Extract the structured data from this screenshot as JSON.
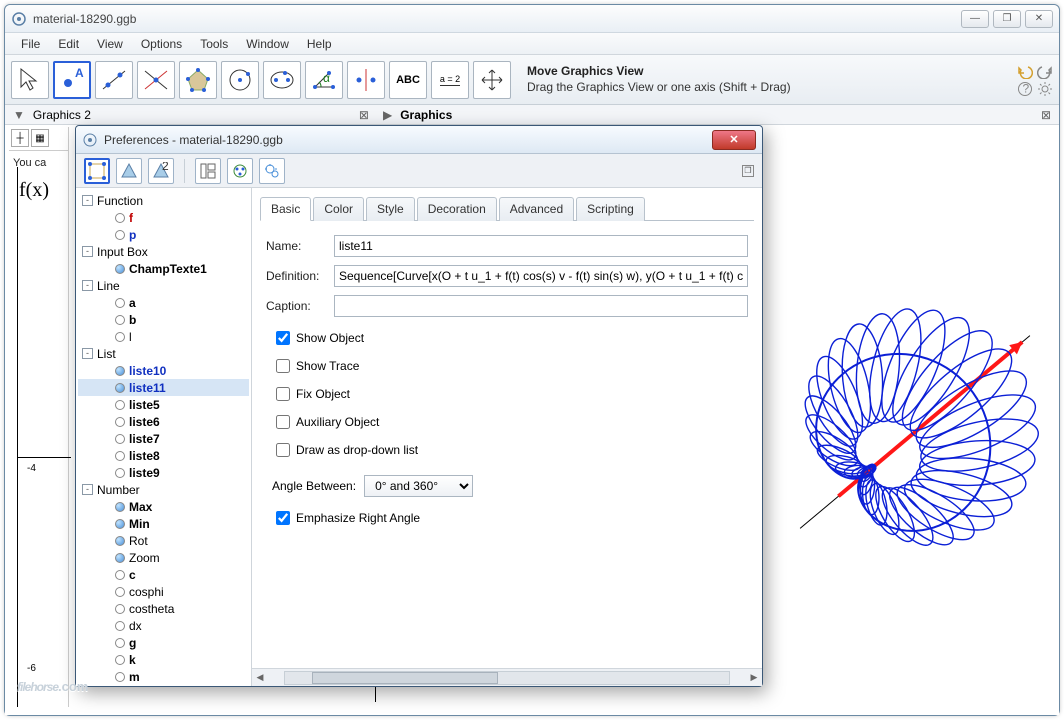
{
  "window": {
    "title": "material-18290.ggb",
    "min": "—",
    "max": "❐",
    "close": "✕"
  },
  "menu": [
    "File",
    "Edit",
    "View",
    "Options",
    "Tools",
    "Window",
    "Help"
  ],
  "toolbar": {
    "hint_title": "Move Graphics View",
    "hint_sub": "Drag the Graphics View or one axis (Shift + Drag)",
    "label_abc": "ABC",
    "label_a2": "a = 2"
  },
  "panels": {
    "left": "Graphics 2",
    "right": "Graphics"
  },
  "graphics2": {
    "youca": "You ca",
    "fx": "f(x)",
    "tick_neg4": "-4",
    "tick_neg6": "-6"
  },
  "pref": {
    "title": "Preferences - material-18290.ggb",
    "close": "✕",
    "pin": "❐"
  },
  "tree": {
    "categories": [
      {
        "label": "Function",
        "expand": "-",
        "children": [
          {
            "label": "f",
            "style": "red bold",
            "filled": false
          },
          {
            "label": "p",
            "style": "blue bold",
            "filled": false
          }
        ]
      },
      {
        "label": "Input Box",
        "expand": "-",
        "children": [
          {
            "label": "ChampTexte1",
            "style": "bold",
            "filled": true
          }
        ]
      },
      {
        "label": "Line",
        "expand": "-",
        "children": [
          {
            "label": "a",
            "style": "bold",
            "filled": false
          },
          {
            "label": "b",
            "style": "bold",
            "filled": false
          },
          {
            "label": "l",
            "style": "",
            "filled": false
          }
        ]
      },
      {
        "label": "List",
        "expand": "-",
        "children": [
          {
            "label": "liste10",
            "style": "blue bold",
            "filled": true
          },
          {
            "label": "liste11",
            "style": "blue bold selected",
            "filled": true
          },
          {
            "label": "liste5",
            "style": "bold",
            "filled": false
          },
          {
            "label": "liste6",
            "style": "bold",
            "filled": false
          },
          {
            "label": "liste7",
            "style": "bold",
            "filled": false
          },
          {
            "label": "liste8",
            "style": "bold",
            "filled": false
          },
          {
            "label": "liste9",
            "style": "bold",
            "filled": false
          }
        ]
      },
      {
        "label": "Number",
        "expand": "-",
        "children": [
          {
            "label": "Max",
            "style": "bold",
            "filled": true
          },
          {
            "label": "Min",
            "style": "bold",
            "filled": true
          },
          {
            "label": "Rot",
            "style": "",
            "filled": true
          },
          {
            "label": "Zoom",
            "style": "",
            "filled": true
          },
          {
            "label": "c",
            "style": "bold",
            "filled": false
          },
          {
            "label": "cosphi",
            "style": "",
            "filled": false
          },
          {
            "label": "costheta",
            "style": "",
            "filled": false
          },
          {
            "label": "dx",
            "style": "",
            "filled": false
          },
          {
            "label": "g",
            "style": "bold",
            "filled": false
          },
          {
            "label": "k",
            "style": "bold",
            "filled": false
          },
          {
            "label": "m",
            "style": "bold",
            "filled": false
          }
        ]
      }
    ]
  },
  "tabs": [
    "Basic",
    "Color",
    "Style",
    "Decoration",
    "Advanced",
    "Scripting"
  ],
  "form": {
    "name_label": "Name:",
    "name_value": "liste11",
    "def_label": "Definition:",
    "def_value": "Sequence[Curve[x(O + t u_1 + f(t) cos(s) v - f(t) sin(s) w), y(O + t u_1 + f(t) c",
    "cap_label": "Caption:",
    "cap_value": "",
    "show_object": "Show Object",
    "show_trace": "Show Trace",
    "fix_object": "Fix Object",
    "aux_object": "Auxiliary Object",
    "draw_dropdown": "Draw as drop-down list",
    "angle_label": "Angle Between:",
    "angle_value": "0° and 360°",
    "emph_right": "Emphasize Right Angle"
  },
  "watermark": {
    "a": "filehorse",
    "b": ".com"
  }
}
